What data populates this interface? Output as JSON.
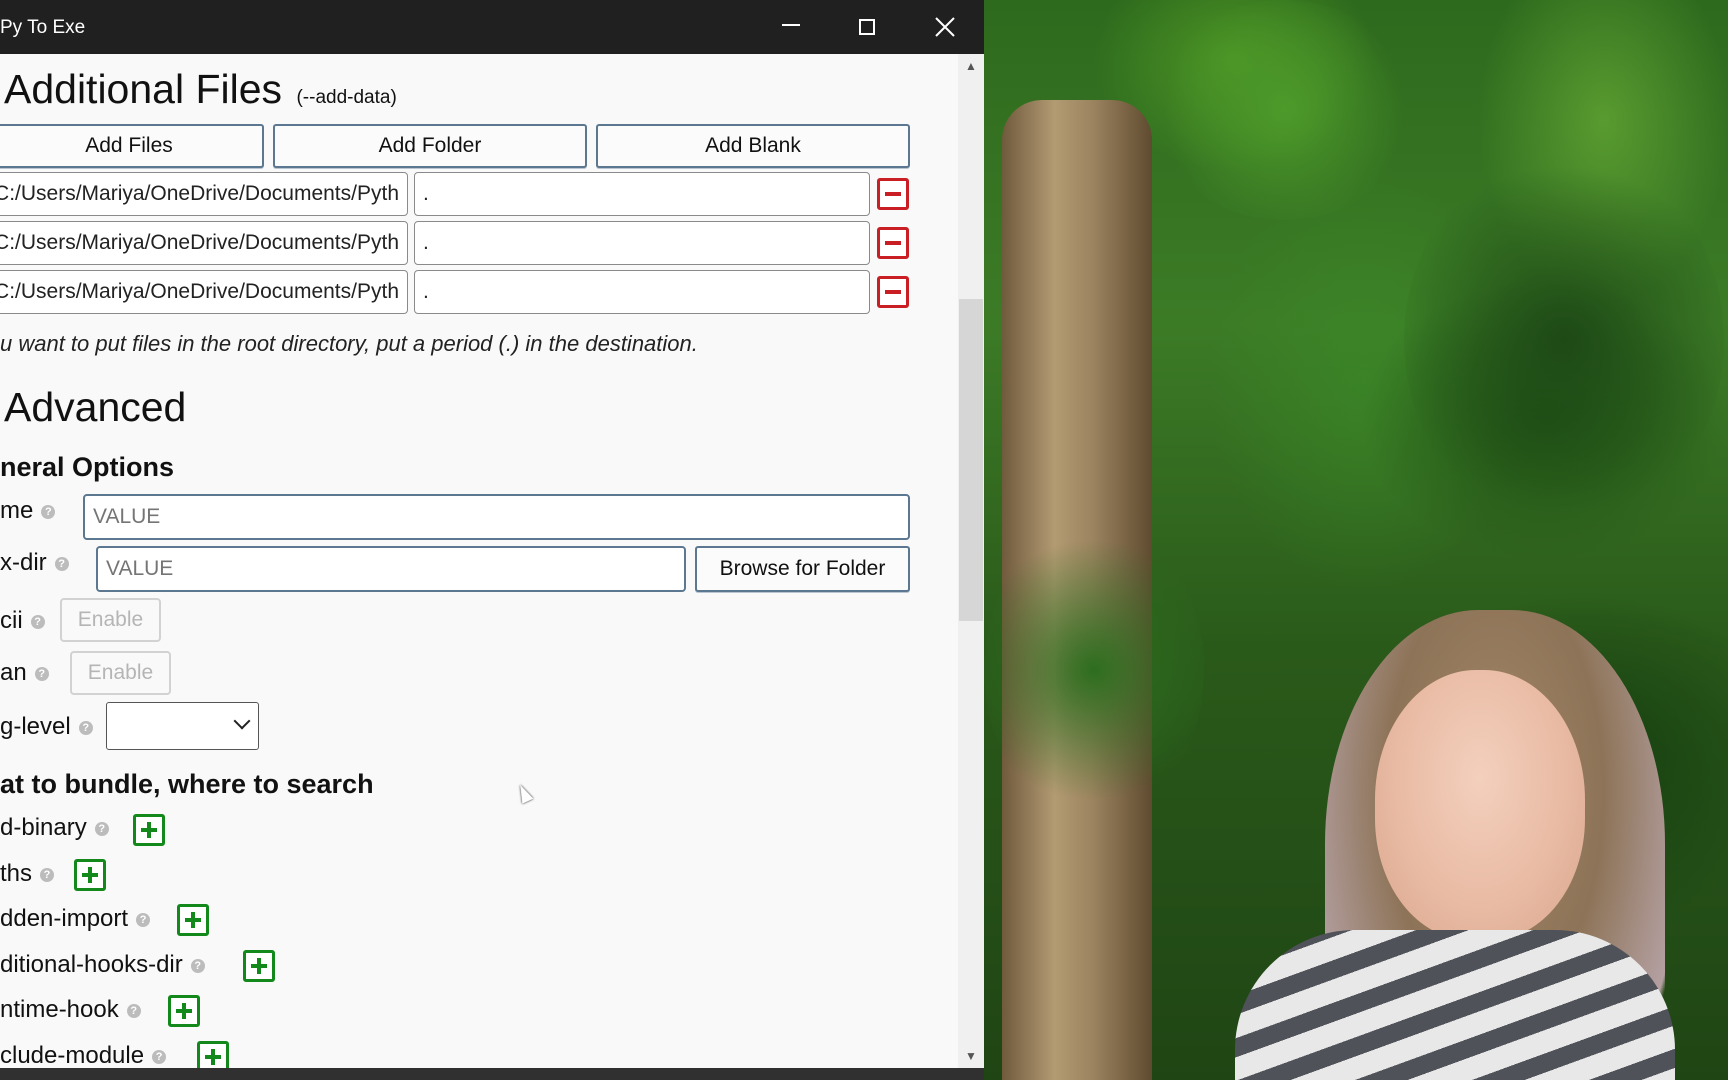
{
  "window": {
    "title": "Py To Exe"
  },
  "additional_files": {
    "heading": "Additional Files",
    "flag": "(--add-data)",
    "buttons": {
      "add_files": "Add Files",
      "add_folder": "Add Folder",
      "add_blank": "Add Blank"
    },
    "rows": [
      {
        "source": "C:/Users/Mariya/OneDrive/Documents/Pyth",
        "destination": "."
      },
      {
        "source": "C:/Users/Mariya/OneDrive/Documents/Pyth",
        "destination": "."
      },
      {
        "source": "C:/Users/Mariya/OneDrive/Documents/Pyth",
        "destination": "."
      }
    ],
    "note": "u want to put files in the root directory, put a period (.) in the destination."
  },
  "advanced": {
    "heading": "Advanced",
    "general_options": {
      "heading": "neral Options",
      "name_label": "me",
      "name_placeholder": "VALUE",
      "upx_label": "x-dir",
      "upx_placeholder": "VALUE",
      "browse_label": "Browse for Folder",
      "ascii_label": "cii",
      "ascii_button": "Enable",
      "clean_label": "an",
      "clean_button": "Enable",
      "loglevel_label": "g-level",
      "loglevel_value": ""
    },
    "bundle": {
      "heading": "at to bundle, where to search",
      "items": [
        {
          "label": "d-binary"
        },
        {
          "label": "ths"
        },
        {
          "label": "dden-import"
        },
        {
          "label": "ditional-hooks-dir"
        },
        {
          "label": "ntime-hook"
        },
        {
          "label": "clude-module"
        }
      ]
    }
  },
  "icons": {
    "help": "?",
    "scroll_up": "▲",
    "scroll_down": "▼"
  },
  "colors": {
    "titlebar": "#202020",
    "button_border": "#5c7891",
    "remove_red": "#c81e24",
    "add_green": "#12891a"
  }
}
